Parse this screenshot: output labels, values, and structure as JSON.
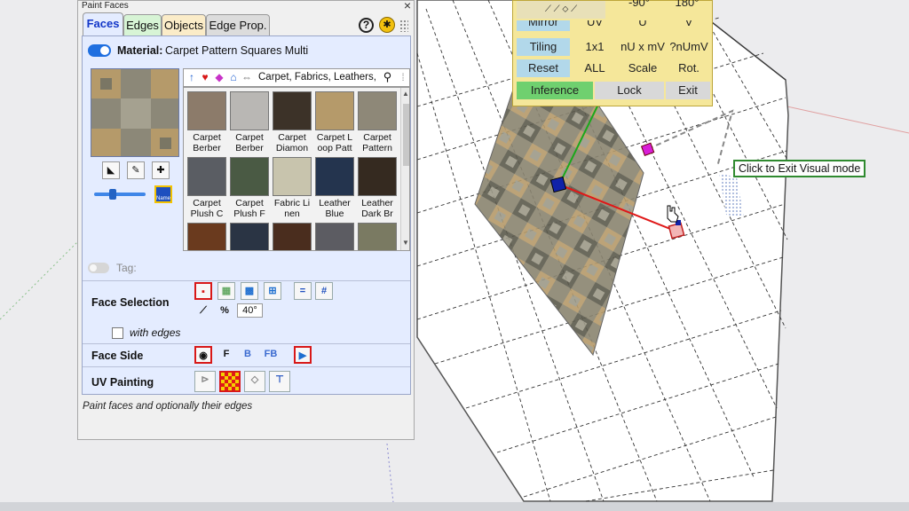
{
  "dialog": {
    "title": "Paint Faces",
    "tabs": [
      "Faces",
      "Edges",
      "Objects",
      "Edge Prop."
    ],
    "help_icon": "?",
    "material_label": "Material:",
    "material_name": "Carpet Pattern Squares Multi",
    "search_text": "Carpet, Fabrics, Leathers,",
    "thumbnails": [
      {
        "line1": "Carpet",
        "line2": "Berber",
        "color": "#8c7b6a"
      },
      {
        "line1": "Carpet",
        "line2": "Berber",
        "color": "#b9b7b4"
      },
      {
        "line1": "Carpet",
        "line2": "Diamon",
        "color": "#3c3228"
      },
      {
        "line1": "Carpet L",
        "line2": "oop Patt",
        "color": "#b59a6a"
      },
      {
        "line1": "Carpet",
        "line2": "Pattern",
        "color": "#8e8878"
      },
      {
        "line1": "Carpet",
        "line2": "Plush C",
        "color": "#5a5d63"
      },
      {
        "line1": "Carpet",
        "line2": "Plush F",
        "color": "#4a5a44"
      },
      {
        "line1": "Fabric Li",
        "line2": "nen",
        "color": "#c8c4ad"
      },
      {
        "line1": "Leather",
        "line2": "Blue",
        "color": "#24344e"
      },
      {
        "line1": "Leather",
        "line2": "Dark Br",
        "color": "#352a20"
      },
      {
        "line1": "",
        "line2": "",
        "color": "#6a3a1e"
      },
      {
        "line1": "",
        "line2": "",
        "color": "#2a3444"
      },
      {
        "line1": "",
        "line2": "",
        "color": "#4a2d1e"
      },
      {
        "line1": "",
        "line2": "",
        "color": "#5c5c62"
      },
      {
        "line1": "",
        "line2": "",
        "color": "#7a7a62"
      }
    ],
    "tag_label": "Tag:",
    "face_selection_label": "Face Selection",
    "angle_value": "40°",
    "with_edges_label": "with edges",
    "face_side_label": "Face Side",
    "face_side_options": [
      "F",
      "B",
      "FB"
    ],
    "uv_painting_label": "UV Painting",
    "status_text": "Paint faces and optionally their edges",
    "name_button": "Name"
  },
  "palette": {
    "row0": [
      "-90°",
      "180°"
    ],
    "mirror": [
      "Mirror",
      "UV",
      "U",
      "V"
    ],
    "tiling": [
      "Tiling",
      "1x1",
      "nU x mV",
      "?nUmV"
    ],
    "reset": [
      "Reset",
      "ALL",
      "Scale",
      "Rot."
    ],
    "controls": [
      "Inference",
      "Lock",
      "Exit"
    ]
  },
  "tooltip": "Click to Exit Visual mode"
}
